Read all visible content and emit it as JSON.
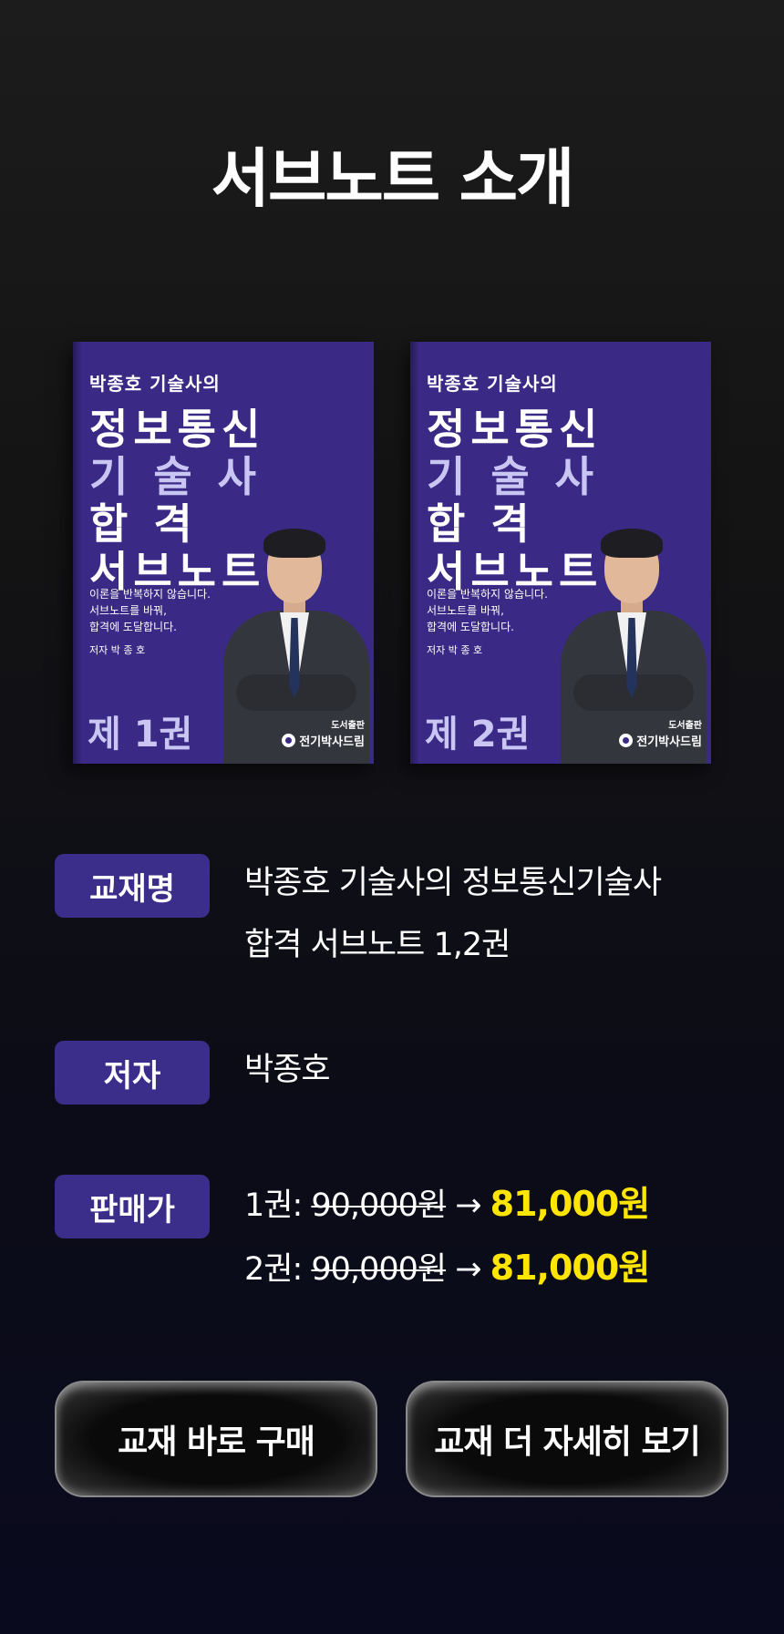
{
  "header": {
    "title": "서브노트 소개"
  },
  "books": [
    {
      "subtitle": "박종호 기술사의",
      "title_lines": [
        "정보통신",
        "기 술 사",
        "합    격",
        "서브노트"
      ],
      "blurb": "이론을 반복하지 않습니다.\n서브노트를 바꿔,\n합격에 도달합니다.",
      "author": "저자  박 종 호",
      "volume": "제 1권",
      "publisher_label": "도서출판",
      "publisher": "전기박사드림"
    },
    {
      "subtitle": "박종호 기술사의",
      "title_lines": [
        "정보통신",
        "기 술 사",
        "합    격",
        "서브노트"
      ],
      "blurb": "이론을 반복하지 않습니다.\n서브노트를 바꿔,\n합격에 도달합니다.",
      "author": "저자  박 종 호",
      "volume": "제 2권",
      "publisher_label": "도서출판",
      "publisher": "전기박사드림"
    }
  ],
  "info": {
    "name": {
      "label": "교재명",
      "value": "박종호 기술사의 정보통신기술사\n합격 서브노트 1,2권"
    },
    "author": {
      "label": "저자",
      "value": "박종호"
    },
    "price": {
      "label": "판매가",
      "items": [
        {
          "prefix": "1권: ",
          "original": "90,000원",
          "arrow": " → ",
          "sale": "81,000원"
        },
        {
          "prefix": "2권: ",
          "original": "90,000원",
          "arrow": " → ",
          "sale": "81,000원"
        }
      ]
    }
  },
  "buttons": {
    "buy": "교재 바로 구매",
    "more": "교재 더 자세히 보기"
  },
  "colors": {
    "accent_purple": "#3b2d8a",
    "sale_yellow": "#ffe500"
  }
}
